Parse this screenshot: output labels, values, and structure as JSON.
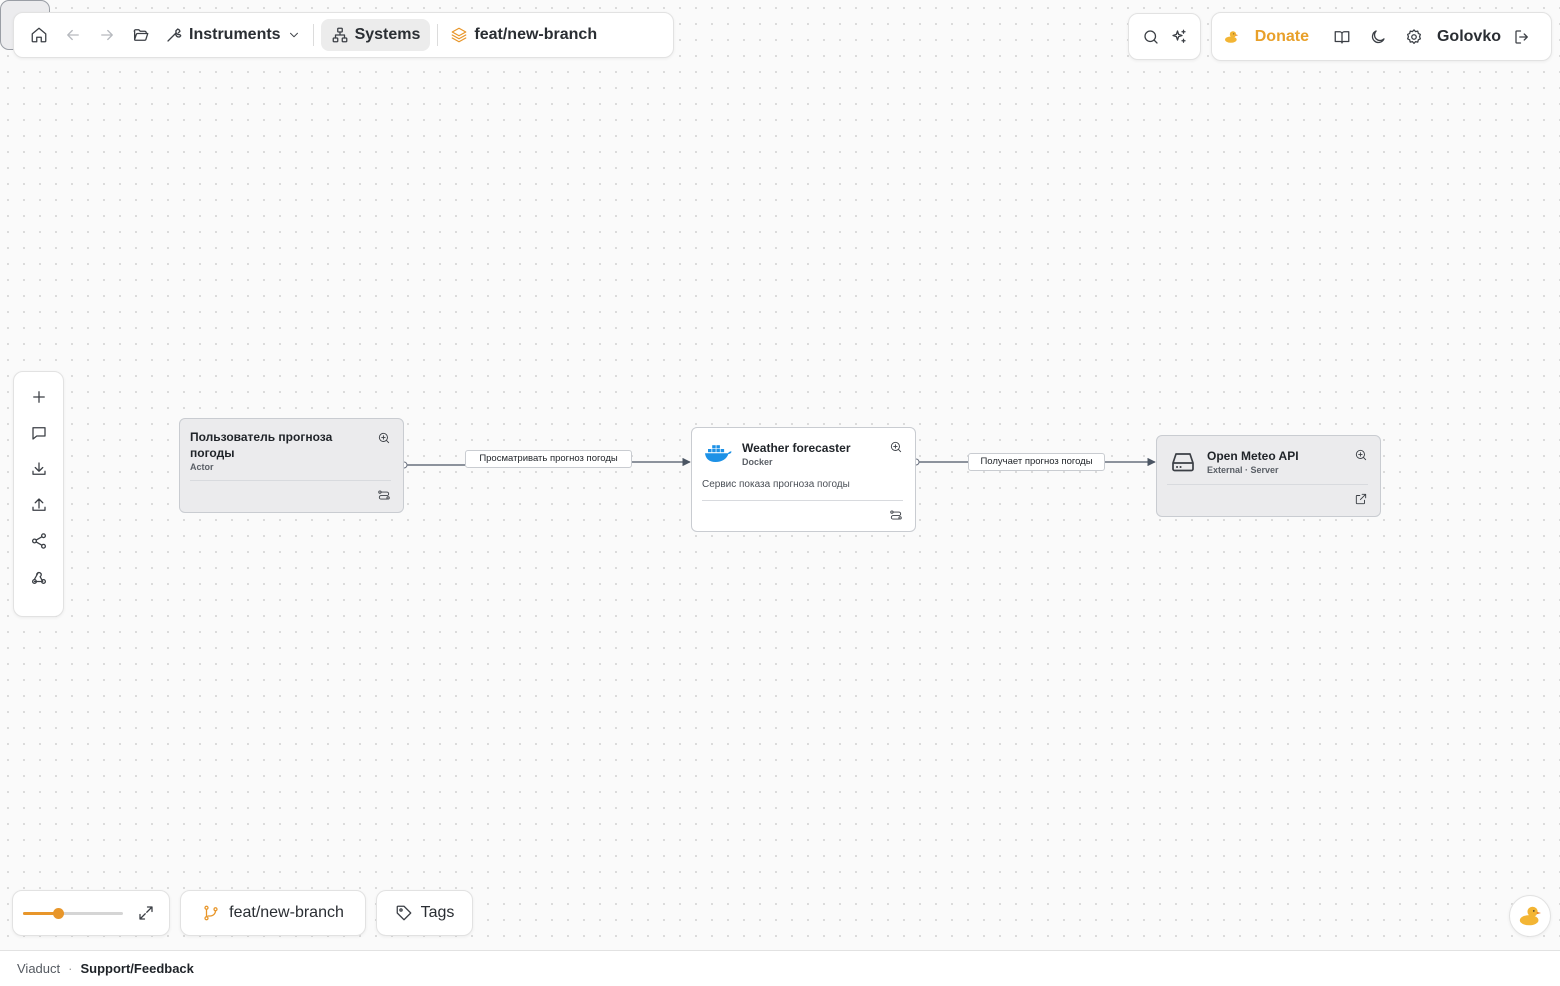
{
  "nav": {
    "instruments_label": "Instruments",
    "systems_label": "Systems",
    "branch_label": "feat/new-branch"
  },
  "user": {
    "donate_label": "Donate",
    "name": "Golovko"
  },
  "diagram": {
    "nodes": [
      {
        "title": "Пользователь прогноза погоды",
        "subtitle": "Actor"
      },
      {
        "title": "Weather forecaster",
        "subtitle": "Docker",
        "description": "Сервис показа прогноза погоды"
      },
      {
        "title": "Open Meteo API",
        "subtitle": "External · Server"
      }
    ],
    "edges": [
      {
        "label": "Просматривать прогноз погоды"
      },
      {
        "label": "Получает прогноз погоды"
      }
    ]
  },
  "bottom": {
    "zoom_level": 0.35,
    "branch_label": "feat/new-branch",
    "tags_label": "Tags"
  },
  "footer": {
    "brand": "Viaduct",
    "separator": "·",
    "support_label": "Support/Feedback"
  },
  "colors": {
    "accent": "#e8962a",
    "docker": "#1d91e6"
  }
}
